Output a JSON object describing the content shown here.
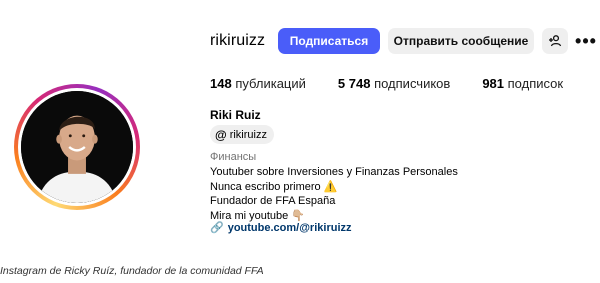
{
  "profile": {
    "username": "rikiruizz",
    "full_name": "Riki Ruiz",
    "threads_handle": "rikiruizz",
    "category": "Финансы",
    "bio_lines": [
      "Youtuber sobre Inversiones y Finanzas Personales",
      "Nunca escribo primero ⚠️",
      "Fundador de FFA España",
      "Mira mi youtube 👇🏼"
    ],
    "link": "youtube.com/@rikiruizz"
  },
  "actions": {
    "follow_label": "Подписаться",
    "message_label": "Отправить сообщение"
  },
  "stats": [
    {
      "value": "148",
      "label": "публикаций"
    },
    {
      "value": "5 748",
      "label": "подписчиков"
    },
    {
      "value": "981",
      "label": "подписок"
    }
  ],
  "caption": "Instagram de Ricky Ruíz, fundador de la comunidad FFA",
  "colors": {
    "follow_button": "#4a5df9",
    "secondary_button": "#efefef",
    "link": "#00376b",
    "category_text": "#737373"
  },
  "icons": {
    "threads": "threads-icon",
    "suggest": "add-person-icon",
    "more": "more-horizontal-icon",
    "link": "link-icon"
  }
}
